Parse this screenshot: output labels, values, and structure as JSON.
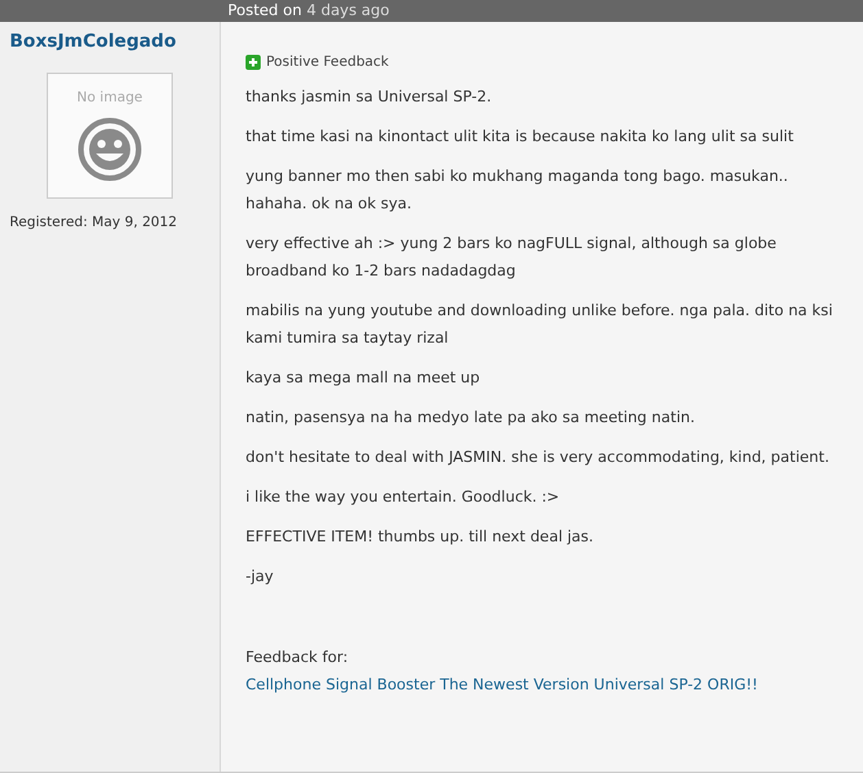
{
  "header": {
    "posted_label": "Posted on",
    "posted_time": "4 days ago"
  },
  "user": {
    "name": "BoxsJmColegado",
    "avatar_text": "No image",
    "registered": "Registered: May 9, 2012"
  },
  "feedback": {
    "positive": true,
    "label": "Positive Feedback",
    "paragraphs": [
      "thanks jasmin sa Universal SP-2.",
      "that time kasi na kinontact ulit kita is because nakita ko lang ulit sa sulit",
      "yung banner mo then sabi ko mukhang maganda tong bago. masukan.. hahaha. ok na ok sya.",
      "very effective ah :> yung 2 bars ko nagFULL signal, although sa globe broadband ko 1-2 bars nadadagdag",
      "mabilis na yung youtube and downloading unlike before. nga pala. dito na ksi kami tumira sa taytay rizal",
      "kaya sa mega mall na meet up",
      "natin, pasensya na ha medyo late pa ako sa meeting natin.",
      "don't hesitate to deal with JASMIN. she is very accommodating, kind, patient.",
      "i like the way you entertain. Goodluck. :>",
      "EFFECTIVE ITEM! thumbs up. till next deal jas.",
      "-jay"
    ],
    "for_label": "Feedback for:",
    "for_link": "Cellphone Signal Booster The Newest Version Universal SP-2 ORIG!!"
  }
}
